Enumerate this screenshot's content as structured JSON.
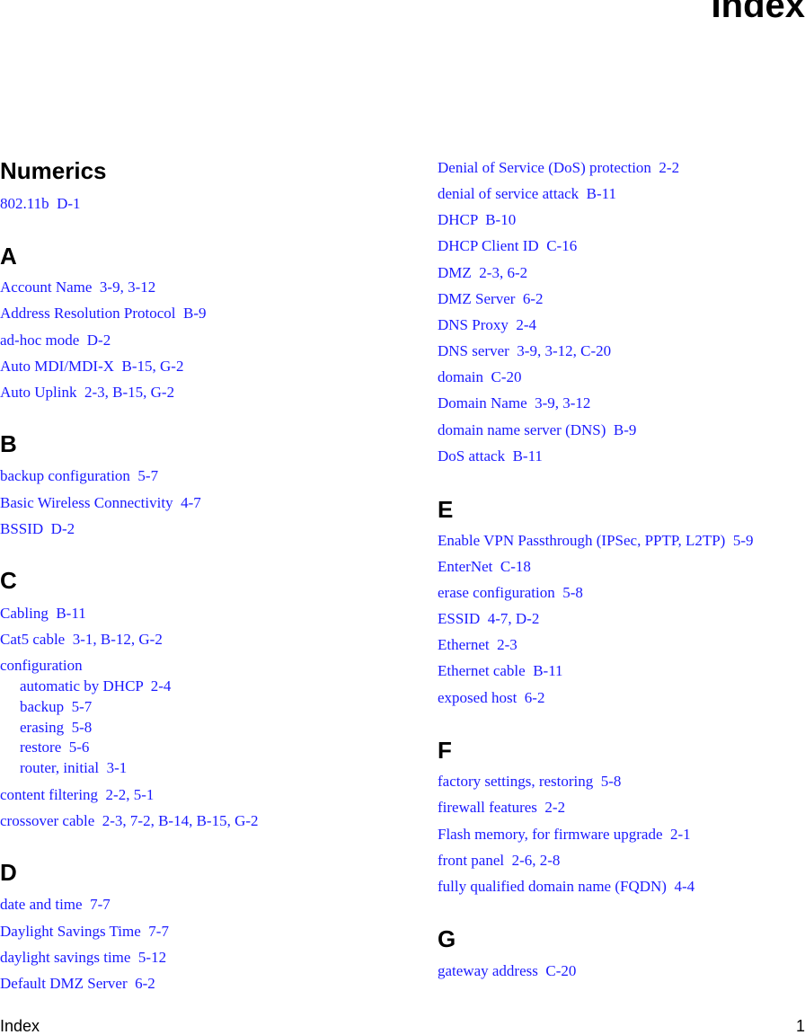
{
  "page": {
    "title": "Index",
    "footer_left": "Index",
    "footer_right": "1"
  },
  "sections": {
    "numerics": {
      "letter": "Numerics",
      "entries": [
        "802.11b  D-1"
      ]
    },
    "a": {
      "letter": "A",
      "entries": [
        "Account Name  3-9, 3-12",
        "Address Resolution Protocol  B-9",
        "ad-hoc mode  D-2",
        "Auto MDI/MDI-X  B-15, G-2",
        "Auto Uplink  2-3, B-15, G-2"
      ]
    },
    "b": {
      "letter": "B",
      "entries": [
        "backup configuration  5-7",
        "Basic Wireless Connectivity  4-7",
        "BSSID  D-2"
      ]
    },
    "c": {
      "letter": "C",
      "entries": [
        "Cabling  B-11",
        "Cat5 cable  3-1, B-12, G-2",
        "configuration"
      ],
      "sub_entries": [
        "automatic by DHCP  2-4",
        "backup  5-7",
        "erasing  5-8",
        "restore  5-6",
        "router, initial  3-1"
      ],
      "entries_after": [
        "content filtering  2-2, 5-1",
        "crossover cable  2-3, 7-2, B-14, B-15, G-2"
      ]
    },
    "d": {
      "letter": "D",
      "entries": [
        "date and time  7-7",
        "Daylight Savings Time  7-7",
        "daylight savings time  5-12",
        "Default DMZ Server  6-2",
        "Denial of Service (DoS) protection  2-2",
        "denial of service attack  B-11",
        "DHCP  B-10",
        "DHCP Client ID  C-16",
        "DMZ  2-3, 6-2",
        "DMZ Server  6-2",
        "DNS Proxy  2-4",
        "DNS server  3-9, 3-12, C-20",
        "domain  C-20",
        "Domain Name  3-9, 3-12",
        "domain name server (DNS)  B-9",
        "DoS attack  B-11"
      ]
    },
    "e": {
      "letter": "E",
      "entries": [
        "Enable VPN Passthrough (IPSec, PPTP, L2TP)  5-9",
        "EnterNet  C-18",
        "erase configuration  5-8",
        "ESSID  4-7, D-2",
        "Ethernet  2-3",
        "Ethernet cable  B-11",
        "exposed host  6-2"
      ]
    },
    "f": {
      "letter": "F",
      "entries": [
        "factory settings, restoring  5-8",
        "firewall features  2-2",
        "Flash memory, for firmware upgrade  2-1",
        "front panel  2-6, 2-8",
        "fully qualified domain name (FQDN)  4-4"
      ]
    },
    "g": {
      "letter": "G",
      "entries": [
        "gateway address  C-20"
      ]
    }
  },
  "colors": {
    "link": "#1a1aff",
    "heading": "#000000"
  }
}
